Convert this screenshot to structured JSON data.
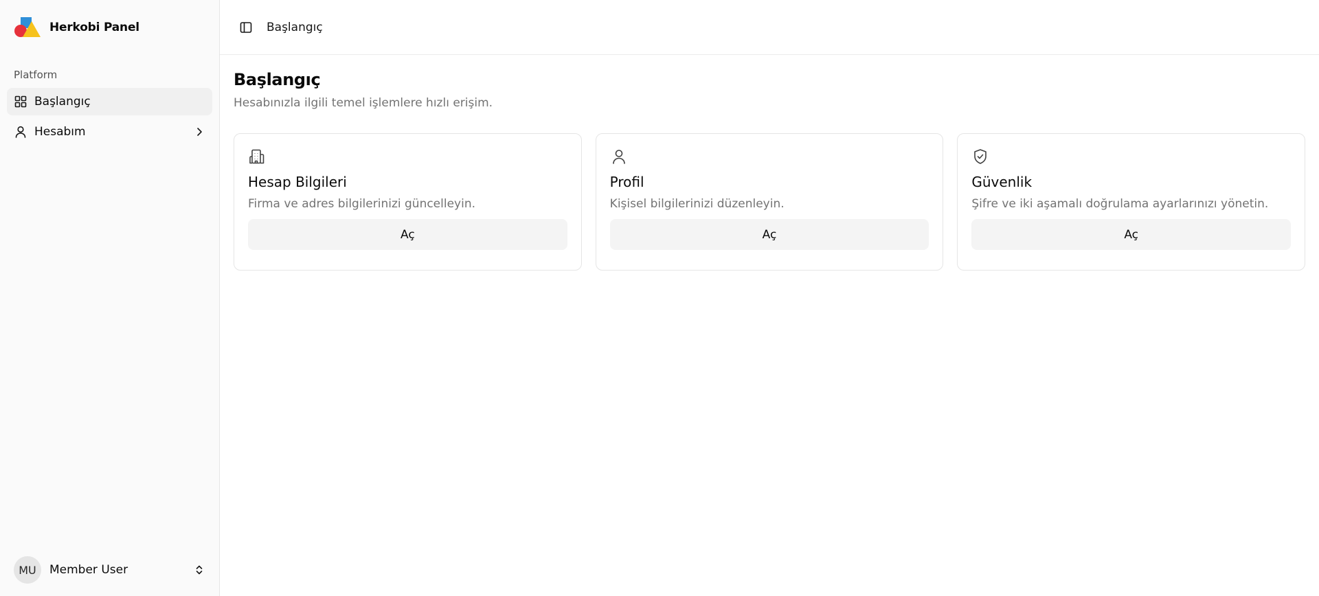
{
  "brand": {
    "name": "Herkobi Panel"
  },
  "sidebar": {
    "group_label": "Platform",
    "items": [
      {
        "label": "Başlangıç",
        "icon": "grid-icon",
        "active": true
      },
      {
        "label": "Hesabım",
        "icon": "user-icon",
        "has_submenu": true
      }
    ],
    "user": {
      "initials": "MU",
      "name": "Member User"
    }
  },
  "header": {
    "breadcrumb": "Başlangıç"
  },
  "main": {
    "title": "Başlangıç",
    "subtitle": "Hesabınızla ilgili temel işlemlere hızlı erişim.",
    "cards": [
      {
        "icon": "building-icon",
        "title": "Hesap Bilgileri",
        "description": "Firma ve adres bilgilerinizi güncelleyin.",
        "button": "Aç"
      },
      {
        "icon": "user-icon",
        "title": "Profil",
        "description": "Kişisel bilgilerinizi düzenleyin.",
        "button": "Aç"
      },
      {
        "icon": "shield-check-icon",
        "title": "Güvenlik",
        "description": "Şifre ve iki aşamalı doğrulama ayarlarınızı yönetin.",
        "button": "Aç"
      }
    ]
  },
  "colors": {
    "logo_red": "#e6313b",
    "logo_blue": "#2f8fd8",
    "logo_yellow": "#f6c21c",
    "sidebar_bg": "#fafafa",
    "button_bg": "#f4f4f4"
  }
}
